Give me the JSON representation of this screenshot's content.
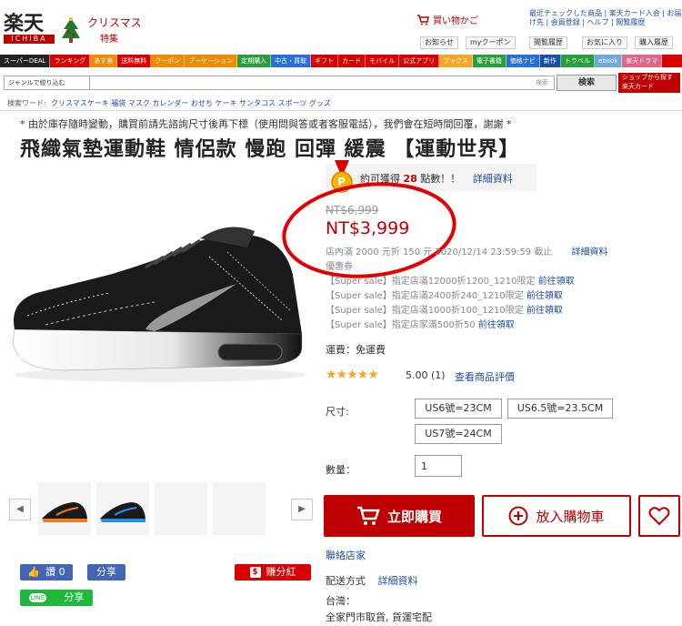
{
  "header": {
    "logo_main": "楽天",
    "logo_r": "R",
    "logo_sub": "ICHIBA",
    "xmas_title": "クリスマス",
    "xmas_sub": "特集",
    "cart_label": "買い物かご",
    "top_links": "最近チェックした商品 | 楽天カード入会 | お届け先 | 会員登録 | ヘルプ | 閲覧履歴",
    "buttons": [
      "お知らせ",
      "myクーポン",
      "閲覧履歴",
      "お気に入り",
      "購入履歴"
    ]
  },
  "nav": {
    "items": [
      "スーパーDEAL",
      "ランキング",
      "あす楽",
      "送料無料",
      "クーポン",
      "ブーケーション",
      "定期購入",
      "中古・買取",
      "ギフト",
      "カード",
      "モバイル",
      "公式アプリ",
      "ブックス",
      "電子書籍",
      "価格ナビ",
      "新作",
      "トラベル",
      "ebook",
      "楽天ドラマ"
    ]
  },
  "search": {
    "genre": "ジャンルで絞り込む",
    "placeholder": "検索",
    "button": "検索",
    "red_button": "ショップから探す 楽天カード"
  },
  "keywords": {
    "label": "検索ワード:",
    "links": "クリスマスケーキ  福袋  マスク  カレンダー  おせち  ケーキ  サンタコス  スポーツ  グッズ"
  },
  "notice": "* 由於庫存隨時變動，購買前請先諮詢尺寸後再下標（使用問與答或者客服電話），我們會在短時間回覆，謝謝 *",
  "title": "飛織氣墊運動鞋 情侶款 慢跑 回彈 緩震 【運動世界】",
  "points": {
    "icon": "P",
    "prefix": "約可獲得",
    "value": "28",
    "suffix": "點數！！",
    "link": "詳細資料"
  },
  "price": {
    "original": "NT$6,999",
    "current": "NT$3,999"
  },
  "coupons": {
    "line1": "店內滿 2000 元折 150 元 2020/12/14 23:59:59 截止",
    "line1_link": "詳細資料",
    "line2": "優惠券",
    "items": [
      {
        "text": "【Super sale】指定店滿12000折1200_1210限定",
        "link": "前往領取"
      },
      {
        "text": "【Super sale】指定店滿2400折240_1210限定",
        "link": "前往領取"
      },
      {
        "text": "【Super sale】指定店滿1000折100_1210限定",
        "link": "前往領取"
      },
      {
        "text": "【Super sale】指定店家滿500折50",
        "link": "前往領取"
      }
    ]
  },
  "shipping": "運費：免運費",
  "rating": {
    "stars": "★★★★★",
    "value": "5.00 (1)",
    "link": "查看商品評價"
  },
  "size": {
    "label": "尺寸:",
    "options": [
      "US6號=23CM",
      "US6.5號=23.5CM",
      "US7號=24CM"
    ]
  },
  "quantity": {
    "label": "數量：",
    "value": "1"
  },
  "actions": {
    "buy": "立即購買",
    "cart": "放入購物車"
  },
  "contact": "聯絡店家",
  "delivery": {
    "label": "配送方式",
    "link": "詳細資料",
    "region": "台灣：",
    "methods": "全家門市取貨, 貨運宅配"
  },
  "social": {
    "like": "讚 0",
    "share": "分享",
    "line_share": "分享",
    "line_label": "LINE",
    "earn": "賺分紅"
  },
  "colors": {
    "brand": "#bf0000",
    "facebook": "#4267b2",
    "line": "#20b83c"
  }
}
